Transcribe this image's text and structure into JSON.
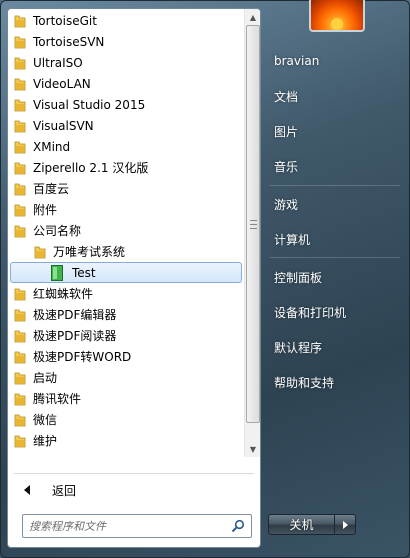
{
  "programs": [
    {
      "label": "TortoiseGit",
      "icon": "folder-icon"
    },
    {
      "label": "TortoiseSVN",
      "icon": "folder-icon"
    },
    {
      "label": "UltraISO",
      "icon": "folder-icon"
    },
    {
      "label": "VideoLAN",
      "icon": "folder-icon"
    },
    {
      "label": "Visual Studio 2015",
      "icon": "folder-icon"
    },
    {
      "label": "VisualSVN",
      "icon": "folder-icon"
    },
    {
      "label": "XMind",
      "icon": "folder-icon"
    },
    {
      "label": "Ziperello 2.1 汉化版",
      "icon": "folder-icon"
    },
    {
      "label": "百度云",
      "icon": "folder-icon"
    },
    {
      "label": "附件",
      "icon": "folder-icon"
    },
    {
      "label": "公司名称",
      "icon": "folder-icon"
    },
    {
      "label": "万唯考试系统",
      "icon": "folder-icon"
    },
    {
      "label": "Test",
      "icon": "app-icon",
      "selected": true
    },
    {
      "label": "红蜘蛛软件",
      "icon": "folder-icon"
    },
    {
      "label": "极速PDF编辑器",
      "icon": "folder-icon"
    },
    {
      "label": "极速PDF阅读器",
      "icon": "folder-icon"
    },
    {
      "label": "极速PDF转WORD",
      "icon": "folder-icon"
    },
    {
      "label": "启动",
      "icon": "folder-icon"
    },
    {
      "label": "腾讯软件",
      "icon": "folder-icon"
    },
    {
      "label": "微信",
      "icon": "folder-icon"
    },
    {
      "label": "维护",
      "icon": "folder-icon"
    }
  ],
  "back": {
    "label": "返回"
  },
  "search": {
    "placeholder": "搜索程序和文件"
  },
  "right_menu": [
    {
      "label": "bravian"
    },
    {
      "label": "文档"
    },
    {
      "label": "图片"
    },
    {
      "label": "音乐"
    },
    {
      "label": "游戏"
    },
    {
      "label": "计算机"
    },
    {
      "label": "控制面板"
    },
    {
      "label": "设备和打印机"
    },
    {
      "label": "默认程序"
    },
    {
      "label": "帮助和支持"
    }
  ],
  "shutdown": {
    "label": "关机"
  },
  "colors": {
    "folder": "#e8b630",
    "selected_bg": "#d5e7fb",
    "app_green": "#2f9a3a"
  }
}
